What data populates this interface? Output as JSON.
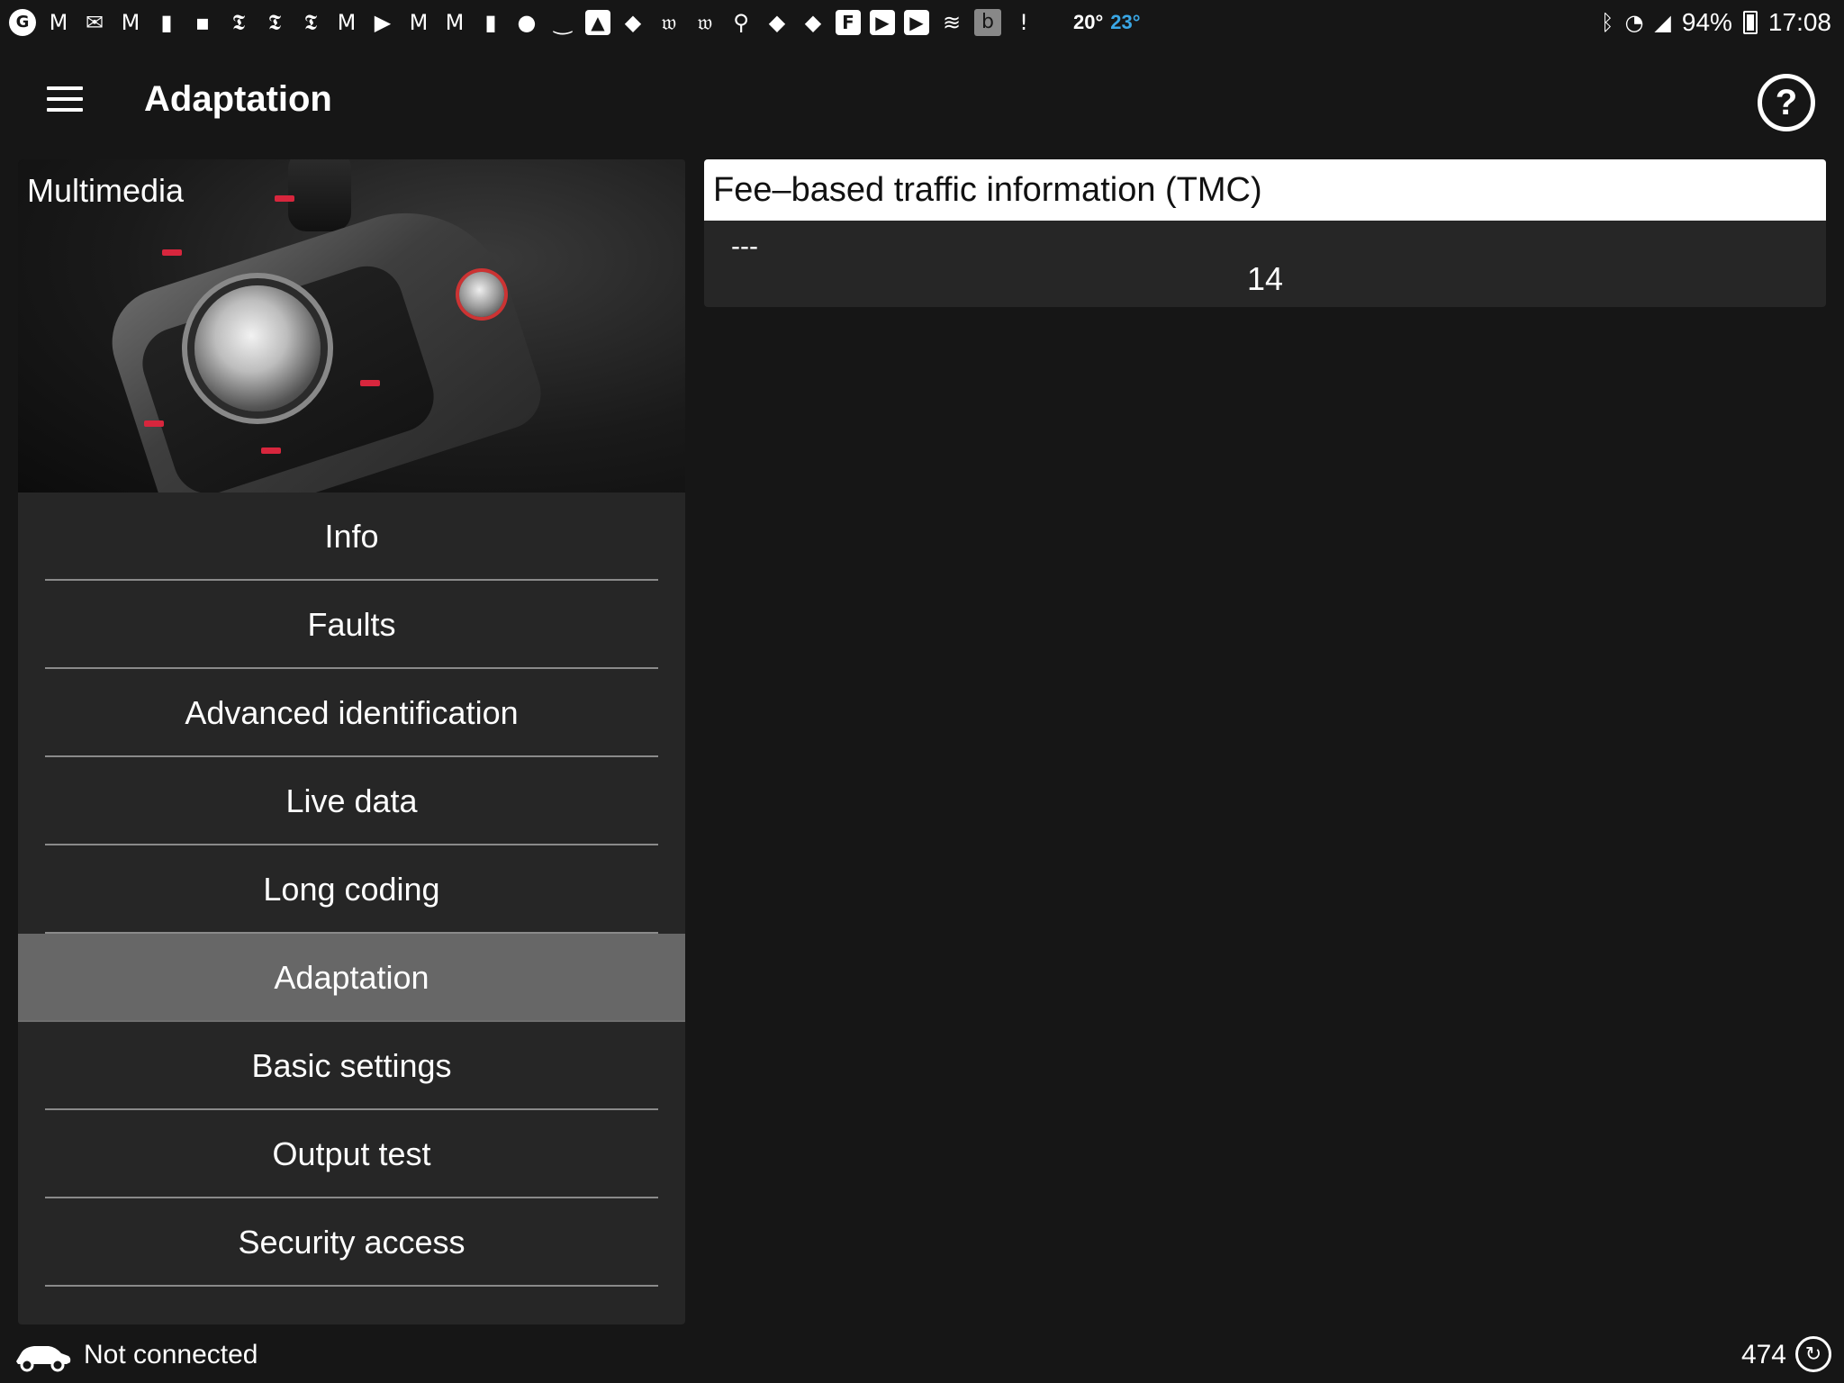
{
  "status_bar": {
    "weather_temp": "20°",
    "weather_temp_high": "23°",
    "battery": "94%",
    "time": "17:08",
    "notification_icons": [
      "google-icon",
      "gmail-icon",
      "mail-icon",
      "gmail-icon",
      "signal-app-icon",
      "news-icon",
      "nyt-icon",
      "nyt-icon",
      "nyt-icon",
      "gmail-icon",
      "play-icon",
      "gmail-icon",
      "gmail-icon",
      "app-icon",
      "app-icon",
      "smile-icon",
      "photo-icon",
      "news-icon",
      "wp-icon",
      "wp-icon",
      "location-icon",
      "news-icon",
      "news-icon",
      "flipboard-icon",
      "youtube-icon",
      "youtube-icon",
      "stack-icon",
      "b-icon",
      "alert-icon"
    ]
  },
  "app_bar": {
    "title": "Adaptation",
    "help_symbol": "?"
  },
  "left_panel": {
    "hero_label": "Multimedia",
    "menu_items": [
      {
        "label": "Info"
      },
      {
        "label": "Faults"
      },
      {
        "label": "Advanced identification"
      },
      {
        "label": "Live data"
      },
      {
        "label": "Long coding"
      },
      {
        "label": "Adaptation",
        "active": true
      },
      {
        "label": "Basic settings"
      },
      {
        "label": "Output test"
      },
      {
        "label": "Security access"
      }
    ]
  },
  "detail": {
    "title": "Fee–based traffic information (TMC)",
    "subtitle": "---",
    "value": "14"
  },
  "footer": {
    "connection_status": "Not connected",
    "counter": "474"
  },
  "colors": {
    "background": "#161616",
    "panel": "#262626",
    "active_item": "#676767",
    "weather_high": "#3aa7e6"
  }
}
